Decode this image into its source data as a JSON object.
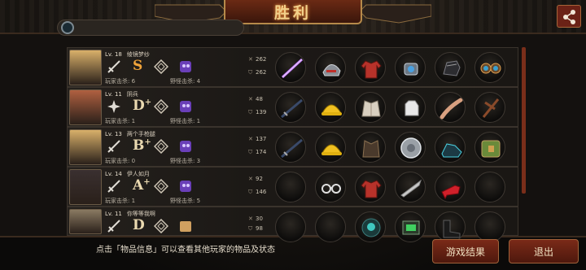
{
  "header": {
    "title": "胜利",
    "share_icon": "share-icon"
  },
  "players": [
    {
      "level": "Lv. 18",
      "name": "绫镜梦纱",
      "grade": "S",
      "grade_plus": "",
      "player_kills": "玩家击杀: 6",
      "monster_kills": "野怪击杀: 4",
      "attack": "262",
      "defense": "262",
      "avatar_color": "#d9b06a",
      "items": [
        "laser-sword-icon",
        "steel-helmet-icon",
        "red-jacket-icon",
        "blue-ring-icon",
        "dark-gauntlet-icon",
        "goggles-icon"
      ]
    },
    {
      "level": "Lv. 11",
      "name": "阴兵",
      "grade": "D",
      "grade_plus": "+",
      "player_kills": "玩家击杀: 1",
      "monster_kills": "野怪击杀: 1",
      "attack": "48",
      "defense": "139",
      "avatar_color": "#b06040",
      "items": [
        "dark-katana-icon",
        "yellow-helmet-icon",
        "cloth-armor-icon",
        "glove-icon",
        "wooden-staff-icon",
        "wooden-cross-icon"
      ]
    },
    {
      "level": "Lv. 13",
      "name": "两个手枪腿",
      "grade": "B",
      "grade_plus": "+",
      "player_kills": "玩家击杀: 0",
      "monster_kills": "野怪击杀: 3",
      "attack": "137",
      "defense": "174",
      "avatar_color": "#d9b06a",
      "items": [
        "dark-katana-icon",
        "yellow-helmet-icon",
        "leather-vest-icon",
        "round-shield-icon",
        "power-boots-icon",
        "treasure-crate-icon"
      ]
    },
    {
      "level": "Lv. 14",
      "name": "伊人如月",
      "grade": "A",
      "grade_plus": "+",
      "player_kills": "玩家击杀: 1",
      "monster_kills": "野怪击杀: 5",
      "attack": "92",
      "defense": "146",
      "avatar_color": "#3a3030",
      "items": [
        "empty-slot",
        "glasses-icon",
        "red-jacket-icon",
        "bone-blade-icon",
        "red-heels-icon",
        "empty-slot"
      ]
    },
    {
      "level": "Lv. 11",
      "name": "你等等我啊",
      "grade": "D",
      "grade_plus": "",
      "player_kills": "",
      "monster_kills": "",
      "attack": "30",
      "defense": "98",
      "avatar_color": "#8a7a62",
      "items": [
        "empty-slot",
        "empty-slot",
        "scuba-helmet-icon",
        "green-chip-icon",
        "black-boots-icon",
        "empty-slot"
      ]
    }
  ],
  "hint_text": "点击「物品信息」可以查看其他玩家的物品及状态",
  "buttons": {
    "result": "游戏结果",
    "exit": "退出"
  },
  "colors": {
    "accent_gold": "#f0a43a",
    "button_red": "#7a2a18",
    "monster_purple": "#6a3fb8"
  }
}
